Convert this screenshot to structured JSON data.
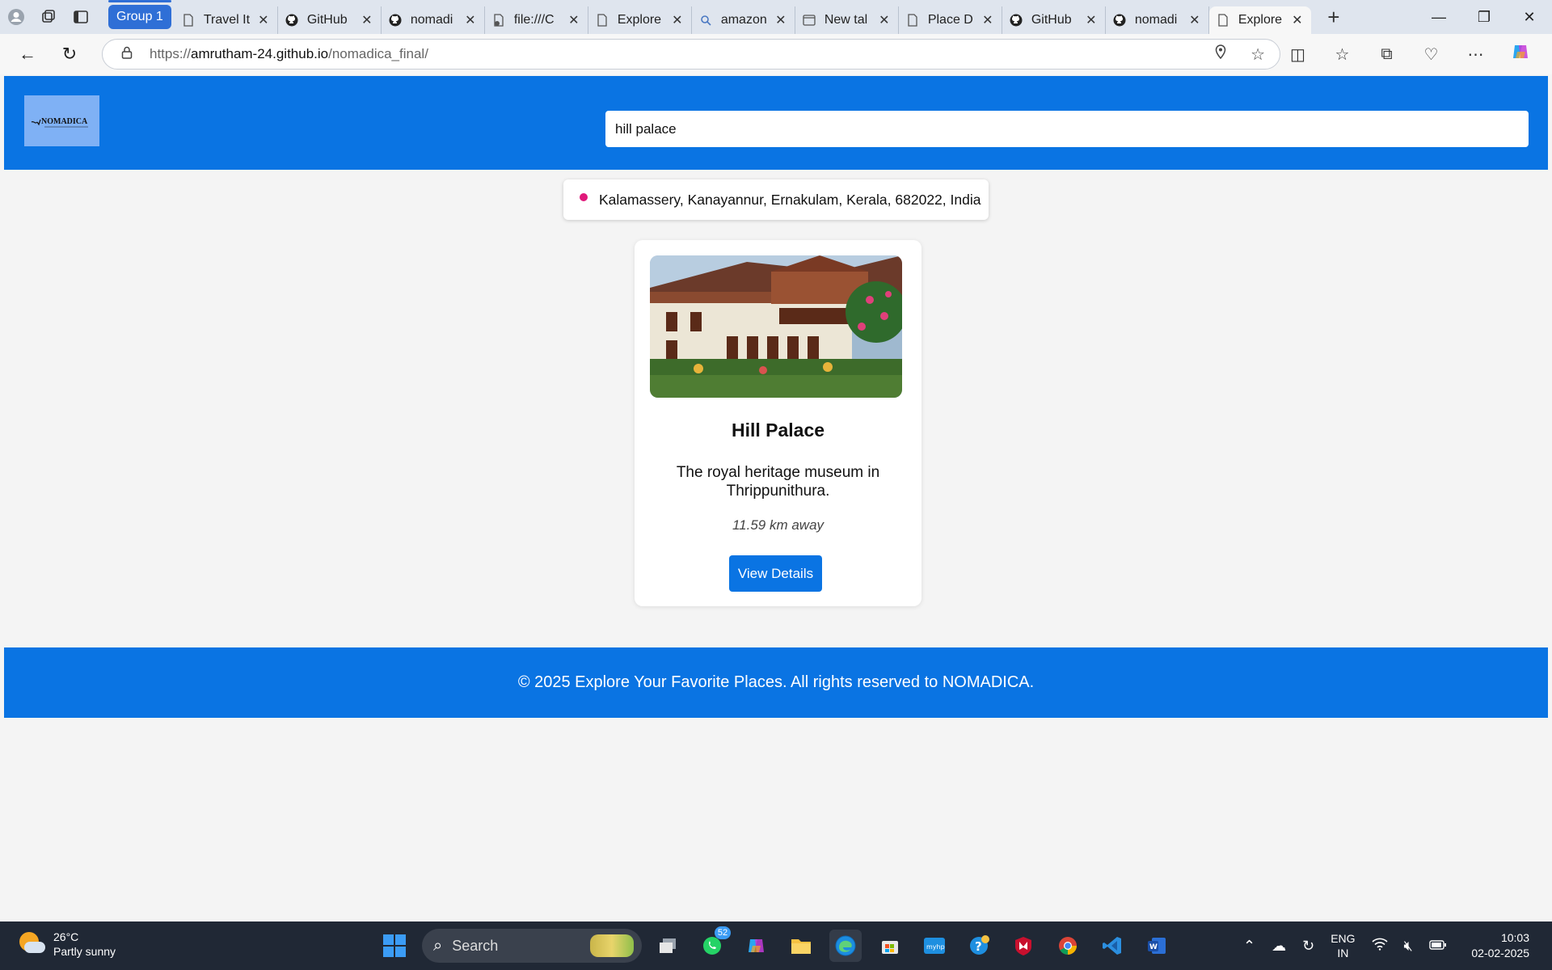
{
  "browser": {
    "group_label": "Group 1",
    "tabs": [
      {
        "title": "Travel It",
        "icon": "page-icon"
      },
      {
        "title": "GitHub",
        "icon": "github-icon"
      },
      {
        "title": "nomadi",
        "icon": "github-icon"
      },
      {
        "title": "file:///C",
        "icon": "file-error-icon"
      },
      {
        "title": "Explore",
        "icon": "page-icon"
      },
      {
        "title": "amazon",
        "icon": "search-icon"
      },
      {
        "title": "New tal",
        "icon": "newtab-icon"
      },
      {
        "title": "Place D",
        "icon": "page-icon"
      },
      {
        "title": "GitHub",
        "icon": "github-icon"
      },
      {
        "title": "nomadi",
        "icon": "github-icon"
      },
      {
        "title": "Explore",
        "icon": "page-icon",
        "active": true
      }
    ],
    "url_prefix": "https://",
    "url_host": "amrutham-24.github.io",
    "url_path": "/nomadica_final/"
  },
  "site": {
    "logo_text": "NOMADICA",
    "search_value": "hill palace",
    "location": "Kalamassery, Kanayannur, Ernakulam, Kerala, 682022, India",
    "card": {
      "title": "Hill Palace",
      "description": "The royal heritage museum in Thrippunithura.",
      "distance": "11.59 km away",
      "button_label": "View Details"
    },
    "footer": "© 2025 Explore Your Favorite Places. All rights reserved to NOMADICA."
  },
  "taskbar": {
    "temperature": "26°C",
    "weather": "Partly sunny",
    "search_label": "Search",
    "whatsapp_badge": "52",
    "lang_line1": "ENG",
    "lang_line2": "IN",
    "time": "10:03",
    "date": "02-02-2025"
  },
  "colors": {
    "brand_blue": "#0a74e3",
    "pin_pink": "#e0187a"
  }
}
